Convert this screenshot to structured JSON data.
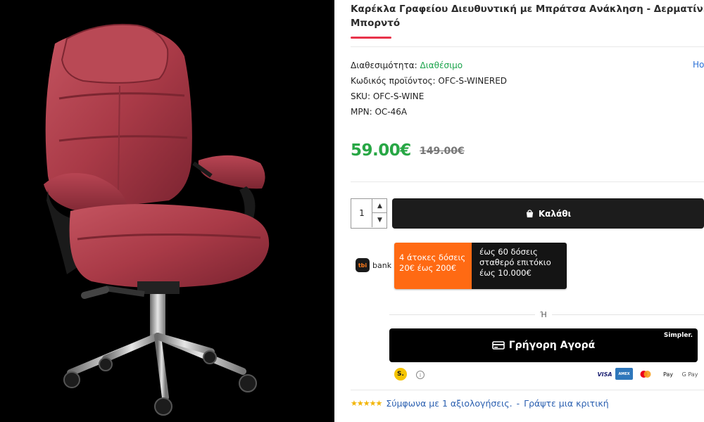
{
  "product": {
    "title_line1": "Καρέκλα Γραφείου Διευθυντική με Μπράτσα Ανάκληση - Δερματίνης",
    "title_line2": "Μπορντό",
    "image_icon": "office-chair-image"
  },
  "meta": {
    "availability_label": "Διαθεσιμότητα:",
    "availability_value": "Διαθέσιμο",
    "code_label": "Κωδικός προϊόντος:",
    "code_value": "OFC-S-WINERED",
    "sku_label": "SKU:",
    "sku_value": "OFC-S-WINE",
    "mpn_label": "MPN:",
    "mpn_value": "OC-46A",
    "side_link": "Ho"
  },
  "pricing": {
    "price": "59.00€",
    "old_price": "149.00€"
  },
  "cart": {
    "quantity": "1",
    "quantity_up_icon": "chevron-up-icon",
    "quantity_down_icon": "chevron-down-icon",
    "add_to_cart_label": "Καλάθι",
    "cart_icon": "bag-icon"
  },
  "installments": {
    "bank_mark": "tbi",
    "bank_name": "bank",
    "left_line1": "4 άτοκες δόσεις",
    "left_line2": "20€ έως 200€",
    "right_line1": "έως 60 δόσεις",
    "right_line2": "σταθερό επιτόκιο",
    "right_line3": "έως 10.000€"
  },
  "checkout": {
    "or_text": "Ή",
    "simpler_tag": "Simpler.",
    "quick_buy_label": "Γρήγορη Αγορά",
    "quick_buy_icon": "card-icon",
    "simpler_badge": "S.",
    "info_icon": "info-icon",
    "payment_methods": [
      "VISA",
      "AMEX",
      "Mastercard",
      "Apple Pay",
      "G Pay"
    ]
  },
  "reviews": {
    "stars": "★★★★★",
    "rating": 5,
    "summary_text": "Σύμφωνα με 1 αξιολογήσεις.",
    "separator": "-",
    "write_review_text": "Γράψτε μια κριτική"
  },
  "colors": {
    "accent_red": "#e8334a",
    "price_green": "#28a745",
    "availability_green": "#19a34a",
    "button_dark": "#1c1c1c",
    "tbi_orange": "#ff6a13",
    "link_blue": "#2a5fb0"
  }
}
